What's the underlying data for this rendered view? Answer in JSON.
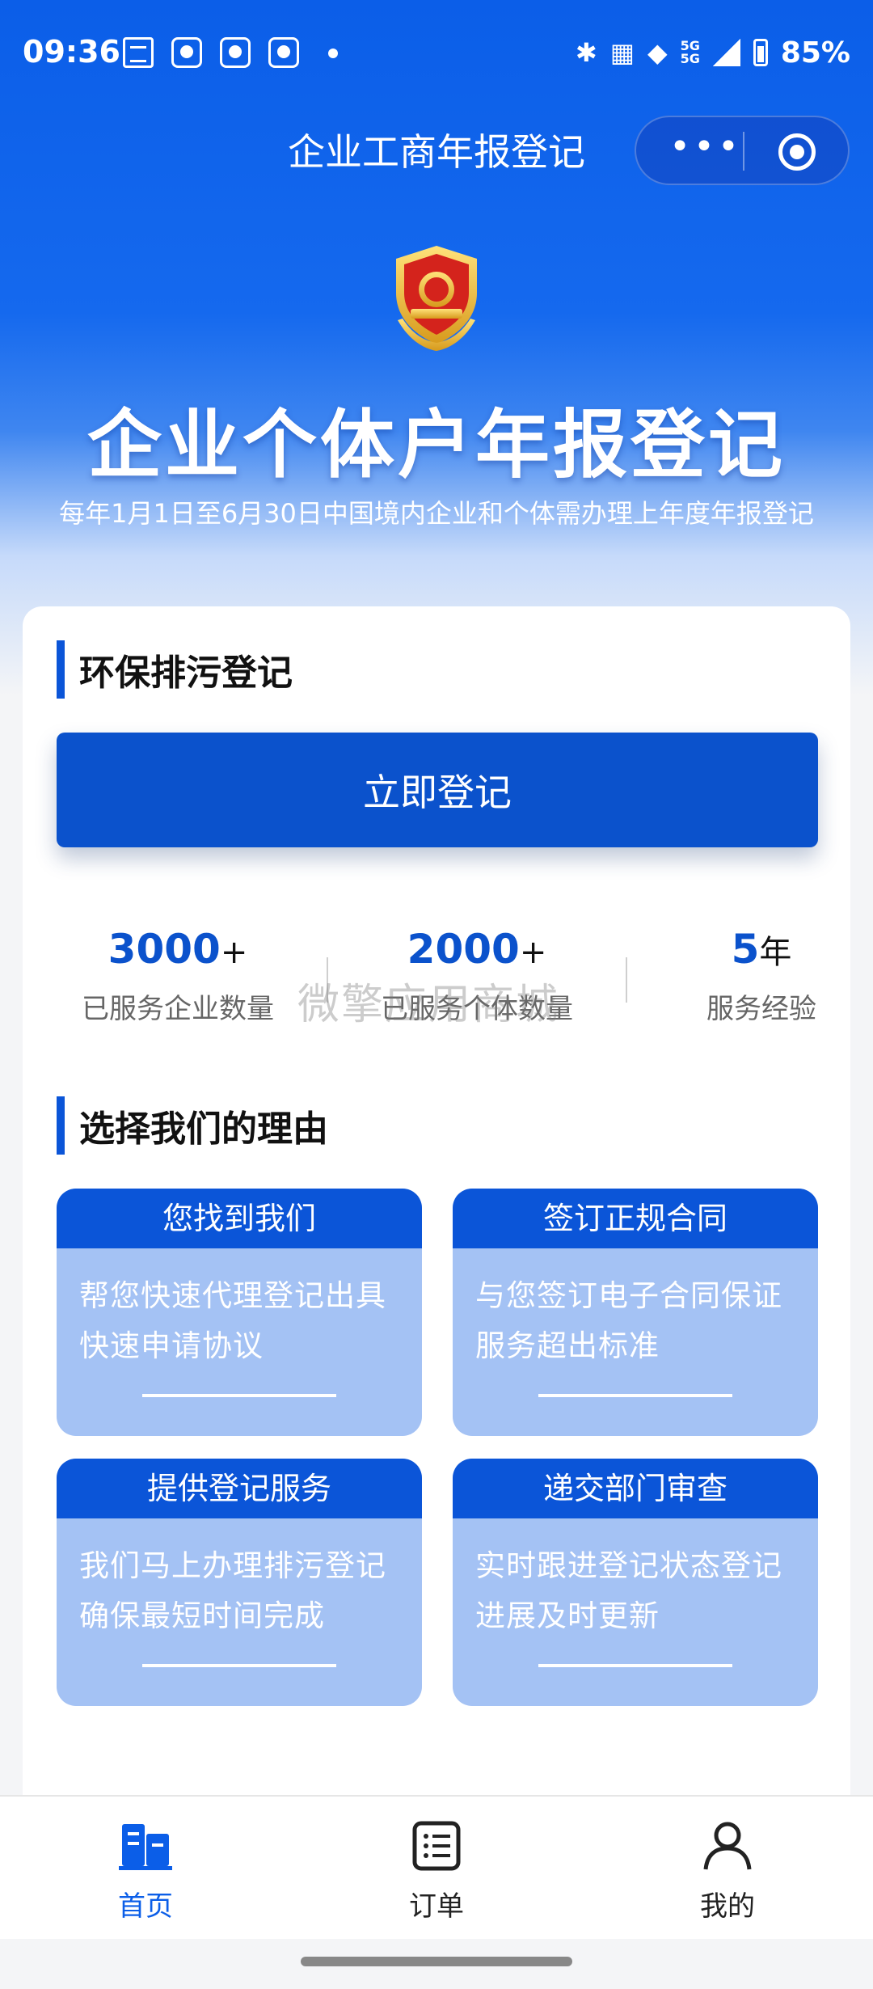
{
  "status_bar": {
    "time": "09:36",
    "battery": "85%",
    "network": "5G",
    "icons": [
      "bluetooth-icon",
      "nfc-icon",
      "wifi-icon",
      "signal-icon",
      "battery-icon"
    ]
  },
  "nav": {
    "title": "企业工商年报登记",
    "more_label": "•••"
  },
  "hero": {
    "title": "企业个体户年报登记",
    "subtitle": "每年1月1日至6月30日中国境内企业和个体需办理上年度年报登记"
  },
  "register": {
    "section_title": "环保排污登记",
    "button_label": "立即登记"
  },
  "stats": [
    {
      "value": "3000",
      "suffix": "+",
      "label": "已服务企业数量"
    },
    {
      "value": "2000",
      "suffix": "+",
      "label": "已服务个体数量"
    },
    {
      "value": "5",
      "suffix": "年",
      "label": "服务经验"
    }
  ],
  "watermark": "微擎应用商城",
  "reasons": {
    "section_title": "选择我们的理由",
    "items": [
      {
        "title": "您找到我们",
        "line1": "帮您快速代理登记出具",
        "line2": "快速申请协议"
      },
      {
        "title": "签订正规合同",
        "line1": "与您签订电子合同保证",
        "line2": "服务超出标准"
      },
      {
        "title": "提供登记服务",
        "line1": "我们马上办理排污登记",
        "line2": "确保最短时间完成"
      },
      {
        "title": "递交部门审查",
        "line1": "实时跟进登记状态登记",
        "line2": "进展及时更新"
      }
    ]
  },
  "tabbar": {
    "items": [
      {
        "label": "首页",
        "icon": "home-building-icon",
        "active": true
      },
      {
        "label": "订单",
        "icon": "order-list-icon",
        "active": false
      },
      {
        "label": "我的",
        "icon": "user-icon",
        "active": false
      }
    ]
  },
  "colors": {
    "primary": "#0b52cc",
    "header_blue": "#0b5ee8",
    "card_light": "#a4c2f4"
  }
}
